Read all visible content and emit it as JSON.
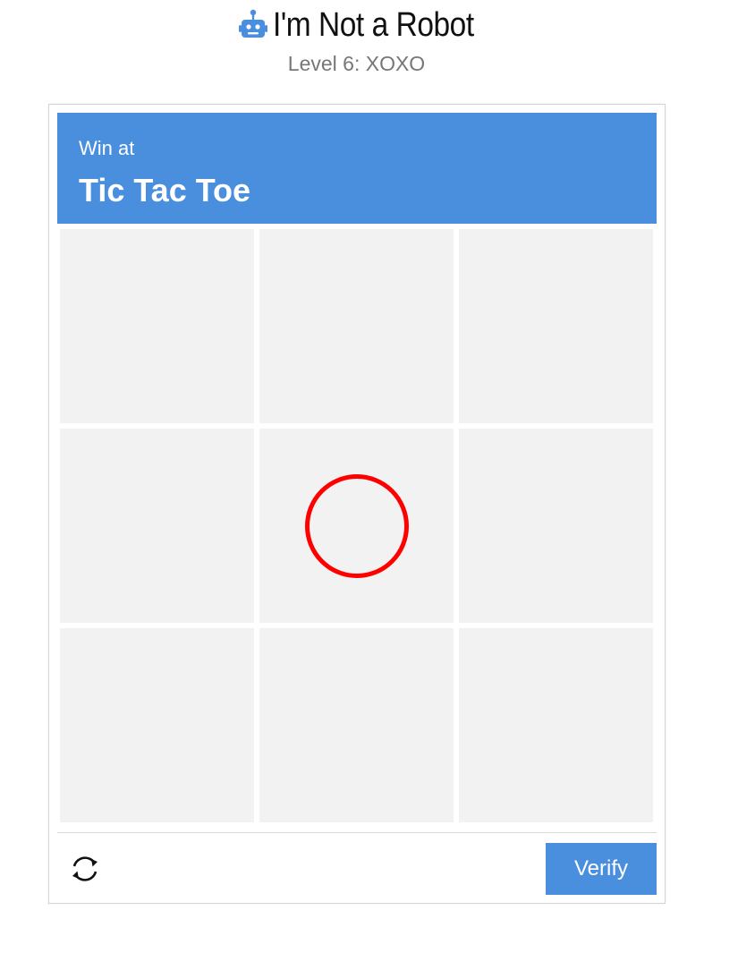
{
  "header": {
    "title": "I'm Not a Robot",
    "subtitle": "Level 6: XOXO",
    "icon": "robot-icon"
  },
  "challenge": {
    "instruction_small": "Win at",
    "instruction_big": "Tic Tac Toe",
    "accent_color": "#4a8ede"
  },
  "board": {
    "cells": [
      "",
      "",
      "",
      "",
      "O",
      "",
      "",
      "",
      ""
    ],
    "o_color": "#ff0000"
  },
  "footer": {
    "refresh_icon": "refresh-icon",
    "verify_label": "Verify"
  }
}
